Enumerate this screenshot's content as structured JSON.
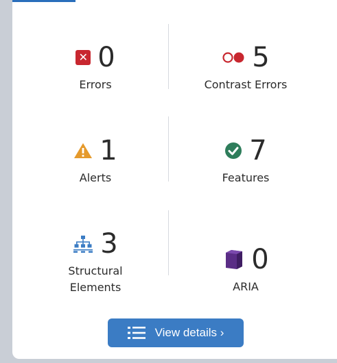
{
  "stats": [
    {
      "key": "errors",
      "count": "0",
      "label": "Errors",
      "icon": "error-x-icon",
      "color": "#c8272f"
    },
    {
      "key": "contrast",
      "count": "5",
      "label": "Contrast Errors",
      "icon": "contrast-icon",
      "color": "#c8272f"
    },
    {
      "key": "alerts",
      "count": "1",
      "label": "Alerts",
      "icon": "alert-triangle-icon",
      "color": "#e59a2c"
    },
    {
      "key": "features",
      "count": "7",
      "label": "Features",
      "icon": "check-circle-icon",
      "color": "#2e7d5b"
    },
    {
      "key": "structural",
      "count": "3",
      "label_line1": "Structural",
      "label_line2": "Elements",
      "icon": "structure-tree-icon",
      "color": "#3b7cc4"
    },
    {
      "key": "aria",
      "count": "0",
      "label": "ARIA",
      "icon": "aria-cube-icon",
      "color": "#5a2d86"
    }
  ],
  "button": {
    "label": "View details ›",
    "icon": "list-icon",
    "color": "#3b7cc4"
  }
}
